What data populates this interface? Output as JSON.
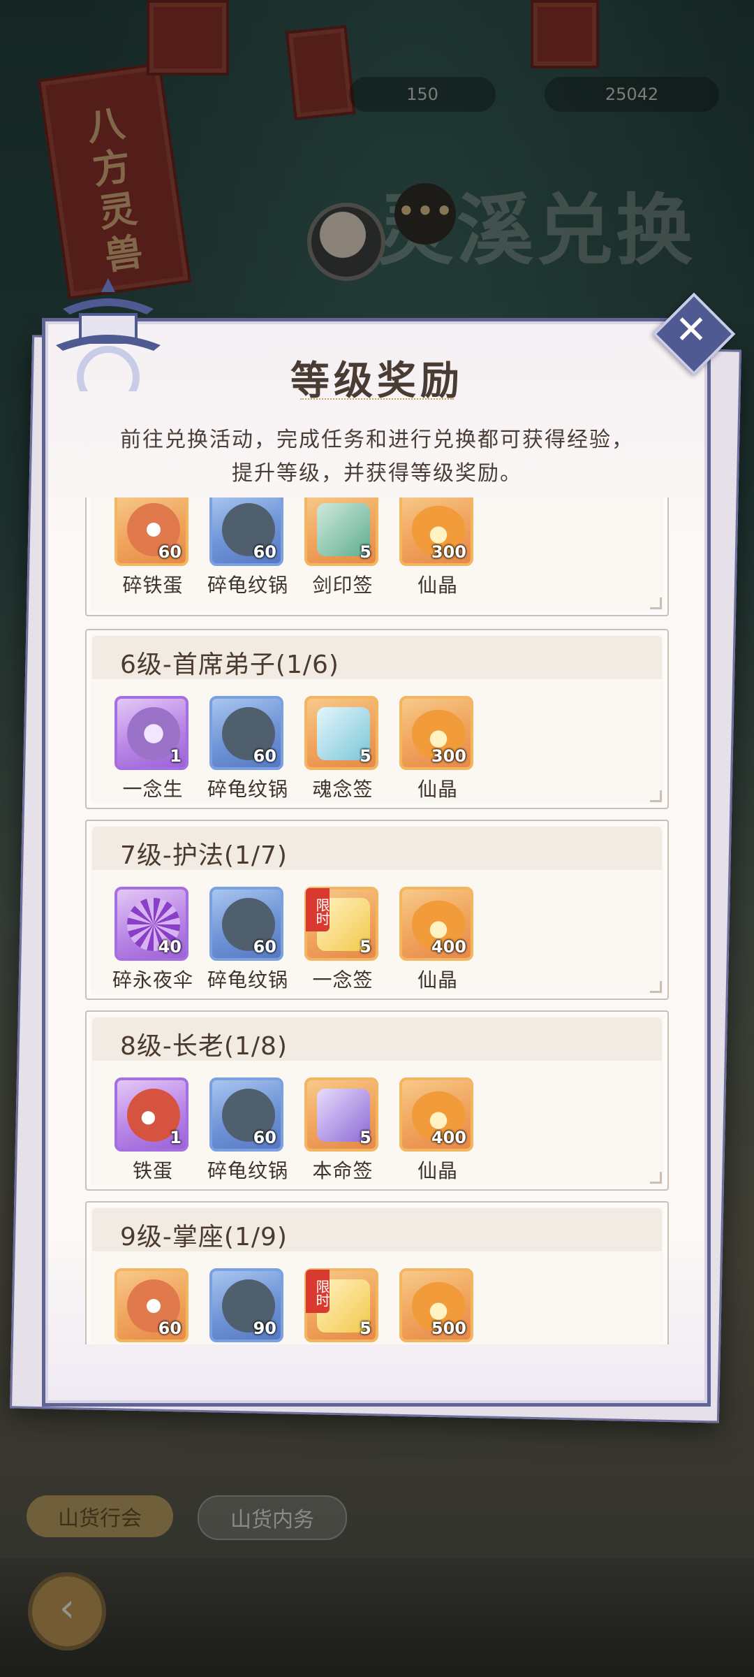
{
  "background": {
    "top_counter_1": "150",
    "top_counter_2": "25042",
    "banner_text": "八方灵兽",
    "page_title": "灵溪兑换",
    "chat_icon": "chat-bubble-icon",
    "tab_1": "山货行会",
    "tab_2": "山货内务"
  },
  "modal": {
    "title": "等级奖励",
    "description_line1": "前往兑换活动，完成任务和进行兑换都可获得经验，",
    "description_line2": "提升等级，并获得等级奖励。",
    "close_icon": "close-icon",
    "limited_tag": "限时",
    "cards": [
      {
        "title": "",
        "items": [
          {
            "name": "碎铁蛋",
            "qty": "60",
            "rarity": "gold",
            "color": "#e07a4d"
          },
          {
            "name": "碎龟纹锅",
            "qty": "60",
            "rarity": "blue",
            "color": "#4f5f6e"
          },
          {
            "name": "剑印签",
            "qty": "5",
            "rarity": "gold",
            "color": "#5fae8e"
          },
          {
            "name": "仙晶",
            "qty": "300",
            "rarity": "gold",
            "color": "#f29b3a"
          }
        ]
      },
      {
        "title": "6级-首席弟子(1/6)",
        "items": [
          {
            "name": "一念生",
            "qty": "1",
            "rarity": "purple",
            "color": "#9a73c9"
          },
          {
            "name": "碎龟纹锅",
            "qty": "60",
            "rarity": "blue",
            "color": "#4f5f6e"
          },
          {
            "name": "魂念签",
            "qty": "5",
            "rarity": "gold",
            "color": "#7cc6d8"
          },
          {
            "name": "仙晶",
            "qty": "300",
            "rarity": "gold",
            "color": "#f29b3a"
          }
        ]
      },
      {
        "title": "7级-护法(1/7)",
        "items": [
          {
            "name": "碎永夜伞",
            "qty": "40",
            "rarity": "purple",
            "color": "#8a3fc9"
          },
          {
            "name": "碎龟纹锅",
            "qty": "60",
            "rarity": "blue",
            "color": "#4f5f6e"
          },
          {
            "name": "一念签",
            "qty": "5",
            "rarity": "gold",
            "color": "#f2c94c",
            "limited": true
          },
          {
            "name": "仙晶",
            "qty": "400",
            "rarity": "gold",
            "color": "#f29b3a"
          }
        ]
      },
      {
        "title": "8级-长老(1/8)",
        "items": [
          {
            "name": "铁蛋",
            "qty": "1",
            "rarity": "purple",
            "color": "#d6533f"
          },
          {
            "name": "碎龟纹锅",
            "qty": "60",
            "rarity": "blue",
            "color": "#4f5f6e"
          },
          {
            "name": "本命签",
            "qty": "5",
            "rarity": "gold",
            "color": "#8c6ad6"
          },
          {
            "name": "仙晶",
            "qty": "400",
            "rarity": "gold",
            "color": "#f29b3a"
          }
        ]
      },
      {
        "title": "9级-掌座(1/9)",
        "items": [
          {
            "name": "",
            "qty": "60",
            "rarity": "gold",
            "color": "#e07a4d"
          },
          {
            "name": "",
            "qty": "90",
            "rarity": "blue",
            "color": "#4f5f6e"
          },
          {
            "name": "",
            "qty": "5",
            "rarity": "gold",
            "color": "#f2c94c",
            "limited": true
          },
          {
            "name": "",
            "qty": "500",
            "rarity": "gold",
            "color": "#f29b3a"
          }
        ]
      }
    ]
  }
}
